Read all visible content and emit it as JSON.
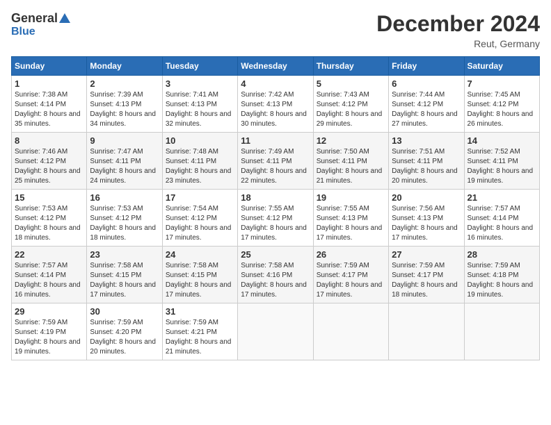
{
  "header": {
    "logo_general": "General",
    "logo_blue": "Blue",
    "month_title": "December 2024",
    "location": "Reut, Germany"
  },
  "weekdays": [
    "Sunday",
    "Monday",
    "Tuesday",
    "Wednesday",
    "Thursday",
    "Friday",
    "Saturday"
  ],
  "weeks": [
    [
      {
        "day": "1",
        "sunrise": "7:38 AM",
        "sunset": "4:14 PM",
        "daylight": "8 hours and 35 minutes."
      },
      {
        "day": "2",
        "sunrise": "7:39 AM",
        "sunset": "4:13 PM",
        "daylight": "8 hours and 34 minutes."
      },
      {
        "day": "3",
        "sunrise": "7:41 AM",
        "sunset": "4:13 PM",
        "daylight": "8 hours and 32 minutes."
      },
      {
        "day": "4",
        "sunrise": "7:42 AM",
        "sunset": "4:13 PM",
        "daylight": "8 hours and 30 minutes."
      },
      {
        "day": "5",
        "sunrise": "7:43 AM",
        "sunset": "4:12 PM",
        "daylight": "8 hours and 29 minutes."
      },
      {
        "day": "6",
        "sunrise": "7:44 AM",
        "sunset": "4:12 PM",
        "daylight": "8 hours and 27 minutes."
      },
      {
        "day": "7",
        "sunrise": "7:45 AM",
        "sunset": "4:12 PM",
        "daylight": "8 hours and 26 minutes."
      }
    ],
    [
      {
        "day": "8",
        "sunrise": "7:46 AM",
        "sunset": "4:12 PM",
        "daylight": "8 hours and 25 minutes."
      },
      {
        "day": "9",
        "sunrise": "7:47 AM",
        "sunset": "4:11 PM",
        "daylight": "8 hours and 24 minutes."
      },
      {
        "day": "10",
        "sunrise": "7:48 AM",
        "sunset": "4:11 PM",
        "daylight": "8 hours and 23 minutes."
      },
      {
        "day": "11",
        "sunrise": "7:49 AM",
        "sunset": "4:11 PM",
        "daylight": "8 hours and 22 minutes."
      },
      {
        "day": "12",
        "sunrise": "7:50 AM",
        "sunset": "4:11 PM",
        "daylight": "8 hours and 21 minutes."
      },
      {
        "day": "13",
        "sunrise": "7:51 AM",
        "sunset": "4:11 PM",
        "daylight": "8 hours and 20 minutes."
      },
      {
        "day": "14",
        "sunrise": "7:52 AM",
        "sunset": "4:11 PM",
        "daylight": "8 hours and 19 minutes."
      }
    ],
    [
      {
        "day": "15",
        "sunrise": "7:53 AM",
        "sunset": "4:12 PM",
        "daylight": "8 hours and 18 minutes."
      },
      {
        "day": "16",
        "sunrise": "7:53 AM",
        "sunset": "4:12 PM",
        "daylight": "8 hours and 18 minutes."
      },
      {
        "day": "17",
        "sunrise": "7:54 AM",
        "sunset": "4:12 PM",
        "daylight": "8 hours and 17 minutes."
      },
      {
        "day": "18",
        "sunrise": "7:55 AM",
        "sunset": "4:12 PM",
        "daylight": "8 hours and 17 minutes."
      },
      {
        "day": "19",
        "sunrise": "7:55 AM",
        "sunset": "4:13 PM",
        "daylight": "8 hours and 17 minutes."
      },
      {
        "day": "20",
        "sunrise": "7:56 AM",
        "sunset": "4:13 PM",
        "daylight": "8 hours and 17 minutes."
      },
      {
        "day": "21",
        "sunrise": "7:57 AM",
        "sunset": "4:14 PM",
        "daylight": "8 hours and 16 minutes."
      }
    ],
    [
      {
        "day": "22",
        "sunrise": "7:57 AM",
        "sunset": "4:14 PM",
        "daylight": "8 hours and 16 minutes."
      },
      {
        "day": "23",
        "sunrise": "7:58 AM",
        "sunset": "4:15 PM",
        "daylight": "8 hours and 17 minutes."
      },
      {
        "day": "24",
        "sunrise": "7:58 AM",
        "sunset": "4:15 PM",
        "daylight": "8 hours and 17 minutes."
      },
      {
        "day": "25",
        "sunrise": "7:58 AM",
        "sunset": "4:16 PM",
        "daylight": "8 hours and 17 minutes."
      },
      {
        "day": "26",
        "sunrise": "7:59 AM",
        "sunset": "4:17 PM",
        "daylight": "8 hours and 17 minutes."
      },
      {
        "day": "27",
        "sunrise": "7:59 AM",
        "sunset": "4:17 PM",
        "daylight": "8 hours and 18 minutes."
      },
      {
        "day": "28",
        "sunrise": "7:59 AM",
        "sunset": "4:18 PM",
        "daylight": "8 hours and 19 minutes."
      }
    ],
    [
      {
        "day": "29",
        "sunrise": "7:59 AM",
        "sunset": "4:19 PM",
        "daylight": "8 hours and 19 minutes."
      },
      {
        "day": "30",
        "sunrise": "7:59 AM",
        "sunset": "4:20 PM",
        "daylight": "8 hours and 20 minutes."
      },
      {
        "day": "31",
        "sunrise": "7:59 AM",
        "sunset": "4:21 PM",
        "daylight": "8 hours and 21 minutes."
      },
      null,
      null,
      null,
      null
    ]
  ]
}
